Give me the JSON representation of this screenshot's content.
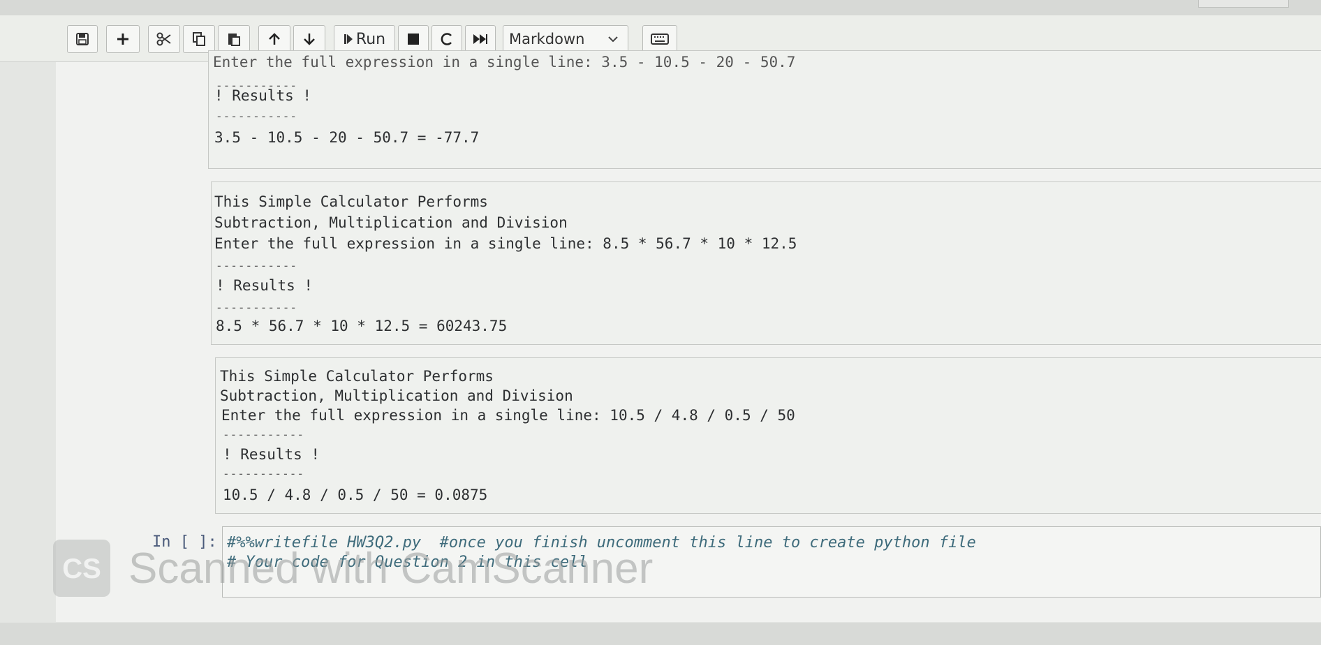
{
  "toolbar": {
    "run_label": "Run",
    "cell_type": "Markdown"
  },
  "cells": [
    {
      "partial_line": "Enter the full expression in a single line: 3.5 - 10.5 - 20 - 50.7",
      "separator": "-----------",
      "results": "! Results !",
      "output": "3.5 - 10.5 - 20 - 50.7 = -77.7"
    },
    {
      "line1": "This Simple Calculator Performs",
      "line2": "Subtraction, Multiplication and Division",
      "line3": "Enter the full expression in a single line: 8.5 * 56.7 * 10 * 12.5",
      "separator": "-----------",
      "results": "! Results !",
      "output": "8.5 * 56.7 * 10 * 12.5 = 60243.75"
    },
    {
      "line1": "This Simple Calculator Performs",
      "line2": "Subtraction, Multiplication and Division",
      "line3": "Enter the full expression in a single line: 10.5 / 4.8 / 0.5 / 50",
      "separator": "-----------",
      "results": "! Results !",
      "output": "10.5 / 4.8 / 0.5 / 50 = 0.0875"
    }
  ],
  "input_cell": {
    "prompt": "In [ ]:",
    "line1": "#%%writefile HW3Q2.py  #once you finish uncomment this line to create python file",
    "line2": "# Your code for Question 2 in this cell"
  },
  "watermark": {
    "logo": "CS",
    "text": "Scanned with CamScanner"
  }
}
